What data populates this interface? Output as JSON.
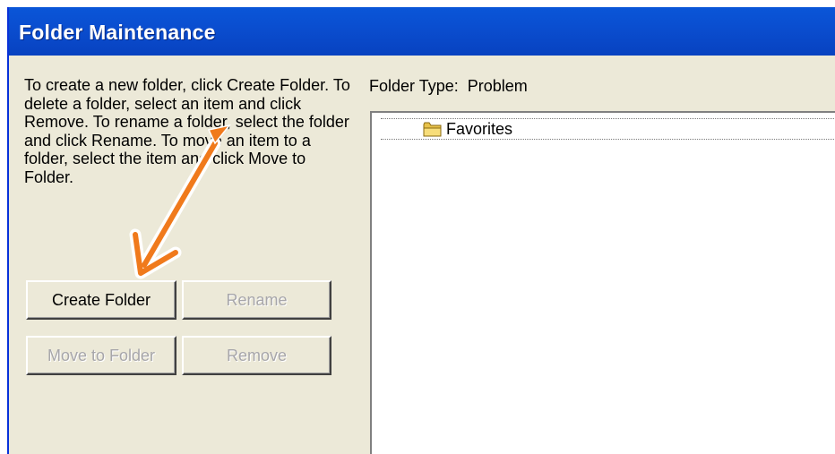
{
  "window": {
    "title": "Folder Maintenance"
  },
  "instructions": {
    "text": "To create a new folder, click Create Folder. To delete a folder, select an item and click Remove. To rename a folder, select the folder and click Rename. To move an item to a folder, select the item and click Move to Folder."
  },
  "folder_type": {
    "label": "Folder Type:",
    "value": "Problem"
  },
  "tree": {
    "items": [
      {
        "label": "Favorites",
        "icon": "folder-icon"
      }
    ]
  },
  "buttons": {
    "create_folder": {
      "label": "Create Folder",
      "enabled": true
    },
    "rename": {
      "label": "Rename",
      "enabled": false
    },
    "move_to_folder": {
      "label": "Move to Folder",
      "enabled": false
    },
    "remove": {
      "label": "Remove",
      "enabled": false
    }
  },
  "annotation": {
    "arrow_color": "#f07a1c",
    "icon": "arrow-icon"
  }
}
